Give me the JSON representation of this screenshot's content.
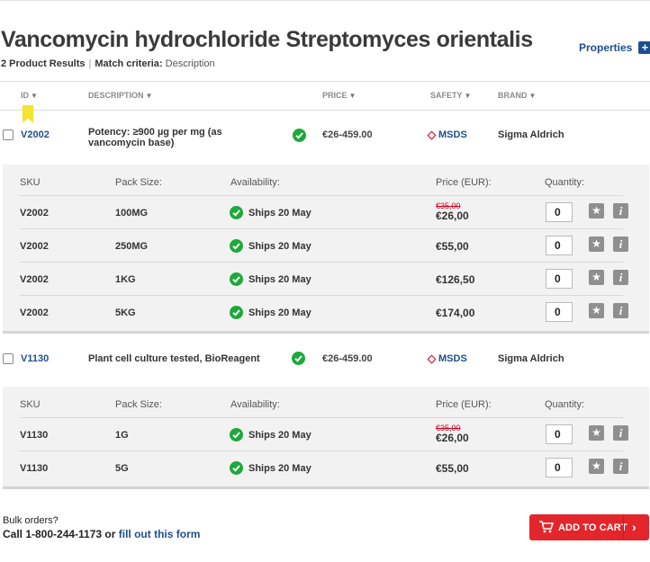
{
  "page": {
    "title": "Vancomycin hydrochloride Streptomyces orientalis",
    "properties_label": "Properties",
    "plus_glyph": "+",
    "results_count": "2 Product Results",
    "match_label": "Match criteria:",
    "match_value": "Description"
  },
  "columns": {
    "id": "ID",
    "description": "DESCRIPTION",
    "price": "PRICE",
    "safety": "SAFETY",
    "brand": "BRAND",
    "sort_glyph": "▼"
  },
  "sku_headers": {
    "sku": "SKU",
    "pack_size": "Pack Size:",
    "availability": "Availability:",
    "price": "Price (EUR):",
    "quantity": "Quantity:"
  },
  "icons": {
    "check": "check-circle-icon",
    "star": "star-icon",
    "info": "info-icon",
    "cart": "cart-icon",
    "bookmark": "bookmark-icon"
  },
  "colors": {
    "link": "#1d4f8f",
    "available": "#1ea83b",
    "cart_button": "#e3262b",
    "sale_price": "#d0021b",
    "bookmark": "#f6e32b"
  },
  "products": [
    {
      "id": "V2002",
      "description": "Potency: ≥900 µg per mg (as vancomycin base)",
      "price": "€26-459.00",
      "safety": "MSDS",
      "brand": "Sigma Aldrich",
      "skus": [
        {
          "sku": "V2002",
          "pack": "100MG",
          "availability": "Ships 20 May",
          "old_price": "€35,00",
          "price": "€26,00",
          "qty": "0"
        },
        {
          "sku": "V2002",
          "pack": "250MG",
          "availability": "Ships 20 May",
          "price": "€55,00",
          "qty": "0"
        },
        {
          "sku": "V2002",
          "pack": "1KG",
          "availability": "Ships 20 May",
          "price": "€126,50",
          "qty": "0"
        },
        {
          "sku": "V2002",
          "pack": "5KG",
          "availability": "Ships 20 May",
          "price": "€174,00",
          "qty": "0"
        }
      ]
    },
    {
      "id": "V1130",
      "description": "Plant cell culture tested, BioReagent",
      "price": "€26-459.00",
      "safety": "MSDS",
      "brand": "Sigma Aldrich",
      "skus": [
        {
          "sku": "V1130",
          "pack": "1G",
          "availability": "Ships 20 May",
          "old_price": "€35,00",
          "price": "€26,00",
          "qty": "0"
        },
        {
          "sku": "V1130",
          "pack": "5G",
          "availability": "Ships 20 May",
          "price": "€55,00",
          "qty": "0"
        }
      ]
    }
  ],
  "footer": {
    "bulk_label": "Bulk orders?",
    "call_text": "Call 1-800-244-1173 or",
    "form_link": "fill out this form",
    "add_to_cart": "ADD TO CART",
    "chevron_glyph": "›"
  }
}
